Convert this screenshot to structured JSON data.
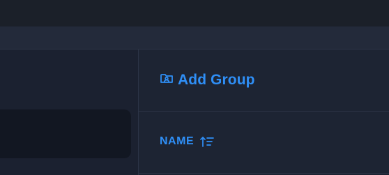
{
  "toolbar": {
    "add_group_label": "Add Group",
    "add_group_icon": "folder-user-icon"
  },
  "table": {
    "columns": [
      {
        "label": "NAME",
        "sort": "ascending",
        "sort_icon": "sort-ascending-icon"
      }
    ]
  },
  "colors": {
    "accent": "#2f8ff7",
    "background": "#1d2433",
    "panel": "#1b2130",
    "input": "#121722",
    "border": "#2c3446"
  }
}
